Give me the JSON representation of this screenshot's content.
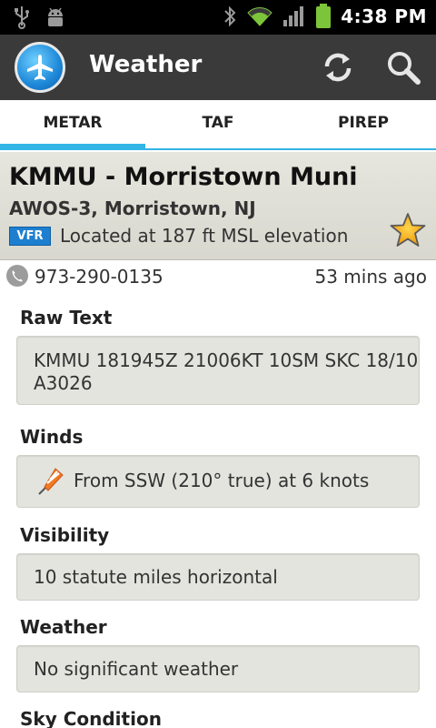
{
  "status_bar": {
    "time": "4:38 PM",
    "icons": [
      "usb-icon",
      "android-debug-icon",
      "bluetooth-icon",
      "wifi-icon",
      "signal-icon",
      "battery-icon"
    ]
  },
  "action_bar": {
    "title": "Weather",
    "app_icon": "airplane-icon",
    "actions": [
      "refresh-icon",
      "search-icon"
    ]
  },
  "tabs": [
    {
      "label": "METAR",
      "selected": true
    },
    {
      "label": "TAF",
      "selected": false
    },
    {
      "label": "PIREP",
      "selected": false
    }
  ],
  "station": {
    "name": "KMMU - Morristown Muni",
    "sub": "AWOS-3, Morristown, NJ",
    "flight_category": "VFR",
    "elevation": "Located at 187 ft MSL elevation",
    "favorite_icon": "star-icon"
  },
  "meta": {
    "phone": "973-290-0135",
    "age": "53 mins ago"
  },
  "sections": {
    "raw_text": {
      "title": "Raw Text",
      "line1": "KMMU 181945Z 21006KT 10SM SKC 18/10",
      "line2": "A3026"
    },
    "winds": {
      "title": "Winds",
      "value": "From SSW (210° true) at 6 knots"
    },
    "visibility": {
      "title": "Visibility",
      "value": "10 statute miles horizontal"
    },
    "weather": {
      "title": "Weather",
      "value": "No significant weather"
    },
    "sky": {
      "title": "Sky Condition"
    }
  },
  "colors": {
    "accent": "#33b5e5",
    "action_bar": "#3a3a3a",
    "vfr": "#1e7fd0"
  }
}
